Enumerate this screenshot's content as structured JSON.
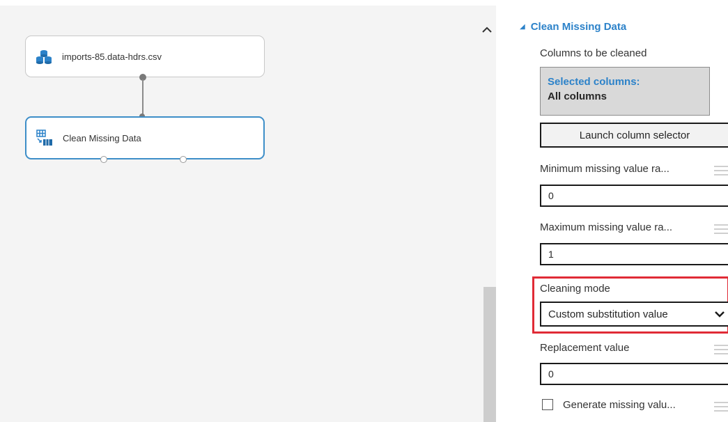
{
  "canvas": {
    "modules": [
      {
        "label": "imports-85.data-hdrs.csv",
        "icon": "dataset-icon"
      },
      {
        "label": "Clean Missing Data",
        "icon": "clean-data-icon"
      }
    ],
    "scroll_up_icon": "chevron-up-icon"
  },
  "panel": {
    "section_title": "Clean Missing Data",
    "columns_label": "Columns to be cleaned",
    "selected_columns_title": "Selected columns:",
    "selected_columns_value": "All columns",
    "launch_button": "Launch column selector",
    "min_ratio_label": "Minimum missing value ra...",
    "min_ratio_value": "0",
    "max_ratio_label": "Maximum missing value ra...",
    "max_ratio_value": "1",
    "cleaning_mode_label": "Cleaning mode",
    "cleaning_mode_value": "Custom substitution value",
    "replacement_label": "Replacement value",
    "replacement_value": "0",
    "generate_indicator_label": "Generate missing valu...",
    "generate_indicator_checked": false
  },
  "colors": {
    "accent": "#2c82c9",
    "highlight": "#e02b36",
    "selected_module_border": "#3d8ec8"
  }
}
